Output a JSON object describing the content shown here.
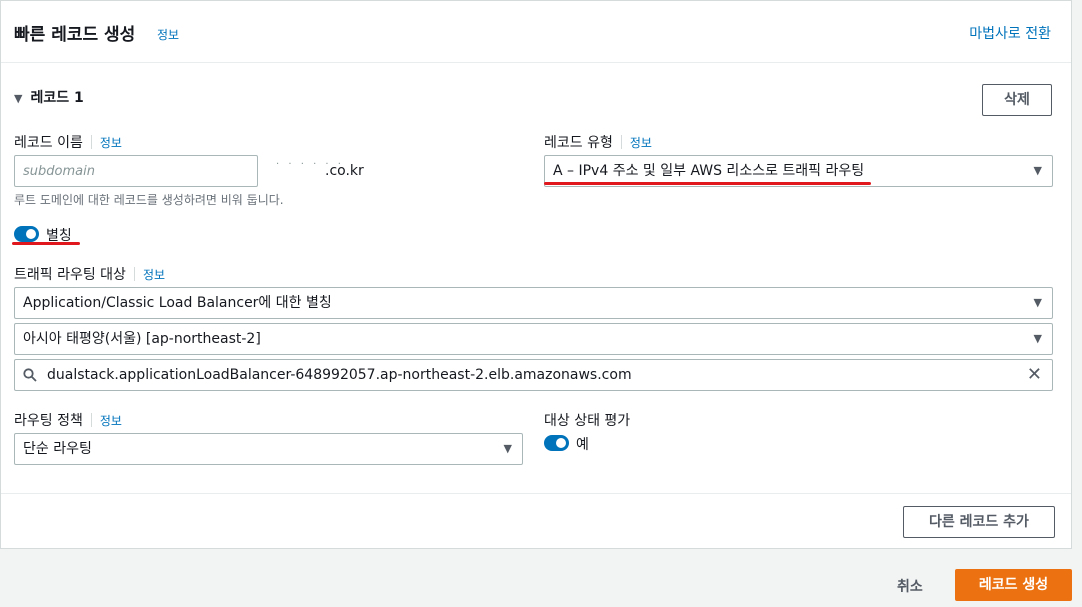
{
  "header": {
    "title": "빠른 레코드 생성",
    "info": "정보",
    "wizard_link": "마법사로 전환"
  },
  "record": {
    "heading": "레코드 1",
    "delete_label": "삭제",
    "name_label": "레코드 이름",
    "name_info": "정보",
    "name_placeholder": "subdomain",
    "domain_mask": "· · · · · ·",
    "domain_suffix": ".co.kr",
    "name_hint": "루트 도메인에 대한 레코드를 생성하려면 비워 둡니다.",
    "type_label": "레코드 유형",
    "type_info": "정보",
    "type_value": "A – IPv4 주소 및 일부 AWS 리소스로 트래픽 라우팅",
    "alias_label": "별칭",
    "alias_on": true,
    "target_label": "트래픽 라우팅 대상",
    "target_info": "정보",
    "endpoint_value": "Application/Classic Load Balancer에 대한 별칭",
    "region_value": "아시아 태평양(서울) [ap-northeast-2]",
    "lb_value": "dualstack.applicationLoadBalancer-648992057.ap-northeast-2.elb.amazonaws.com",
    "policy_label": "라우팅 정책",
    "policy_info": "정보",
    "policy_value": "단순 라우팅",
    "health_label": "대상 상태 평가",
    "health_value": "예",
    "health_on": true
  },
  "footer": {
    "add_record": "다른 레코드 추가",
    "cancel": "취소",
    "create": "레코드 생성"
  },
  "colors": {
    "accent": "#0073bb",
    "primary_button": "#ec7211",
    "highlight_underline": "#e0181e"
  },
  "icons": [
    "caret-down-icon",
    "dropdown-arrow-icon",
    "search-icon",
    "clear-icon",
    "toggle-icon"
  ]
}
